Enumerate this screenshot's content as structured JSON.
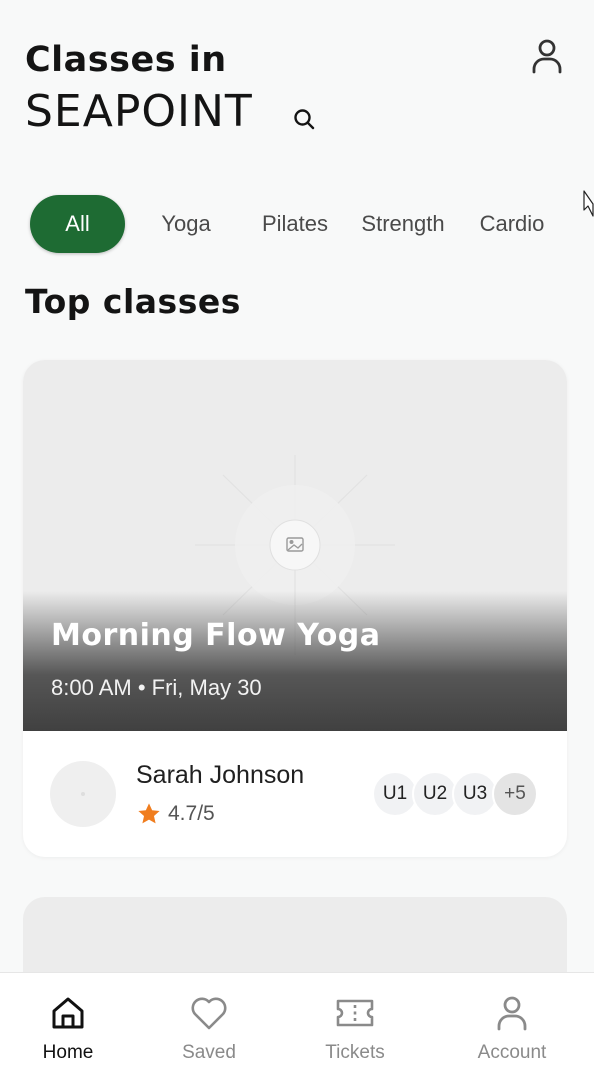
{
  "header": {
    "title_line1": "Classes in",
    "title_line2": "SEAPOINT",
    "search_icon": "search-icon",
    "profile_icon": "user-icon"
  },
  "filters": {
    "active_index": 0,
    "items": [
      {
        "label": "All"
      },
      {
        "label": "Yoga"
      },
      {
        "label": "Pilates"
      },
      {
        "label": "Strength"
      },
      {
        "label": "Cardio"
      }
    ]
  },
  "section": {
    "title": "Top classes"
  },
  "class_card": {
    "title": "Morning Flow Yoga",
    "meta": "8:00 AM • Fri, May 30",
    "image_icon": "image-placeholder-icon",
    "instructor": {
      "name": "Sarah Johnson",
      "rating": "4.7/5",
      "rating_icon": "star-icon"
    },
    "attendees": [
      {
        "label": "U1"
      },
      {
        "label": "U2"
      },
      {
        "label": "U3"
      },
      {
        "label": "+5"
      }
    ]
  },
  "bottom_nav": {
    "items": [
      {
        "label": "Home",
        "icon": "home-icon",
        "active": true
      },
      {
        "label": "Saved",
        "icon": "heart-icon",
        "active": false
      },
      {
        "label": "Tickets",
        "icon": "ticket-icon",
        "active": false
      },
      {
        "label": "Account",
        "icon": "user-icon",
        "active": false
      }
    ]
  },
  "colors": {
    "accent": "#1e6b33",
    "star": "#f07d1e",
    "background": "#f8f9f9"
  }
}
